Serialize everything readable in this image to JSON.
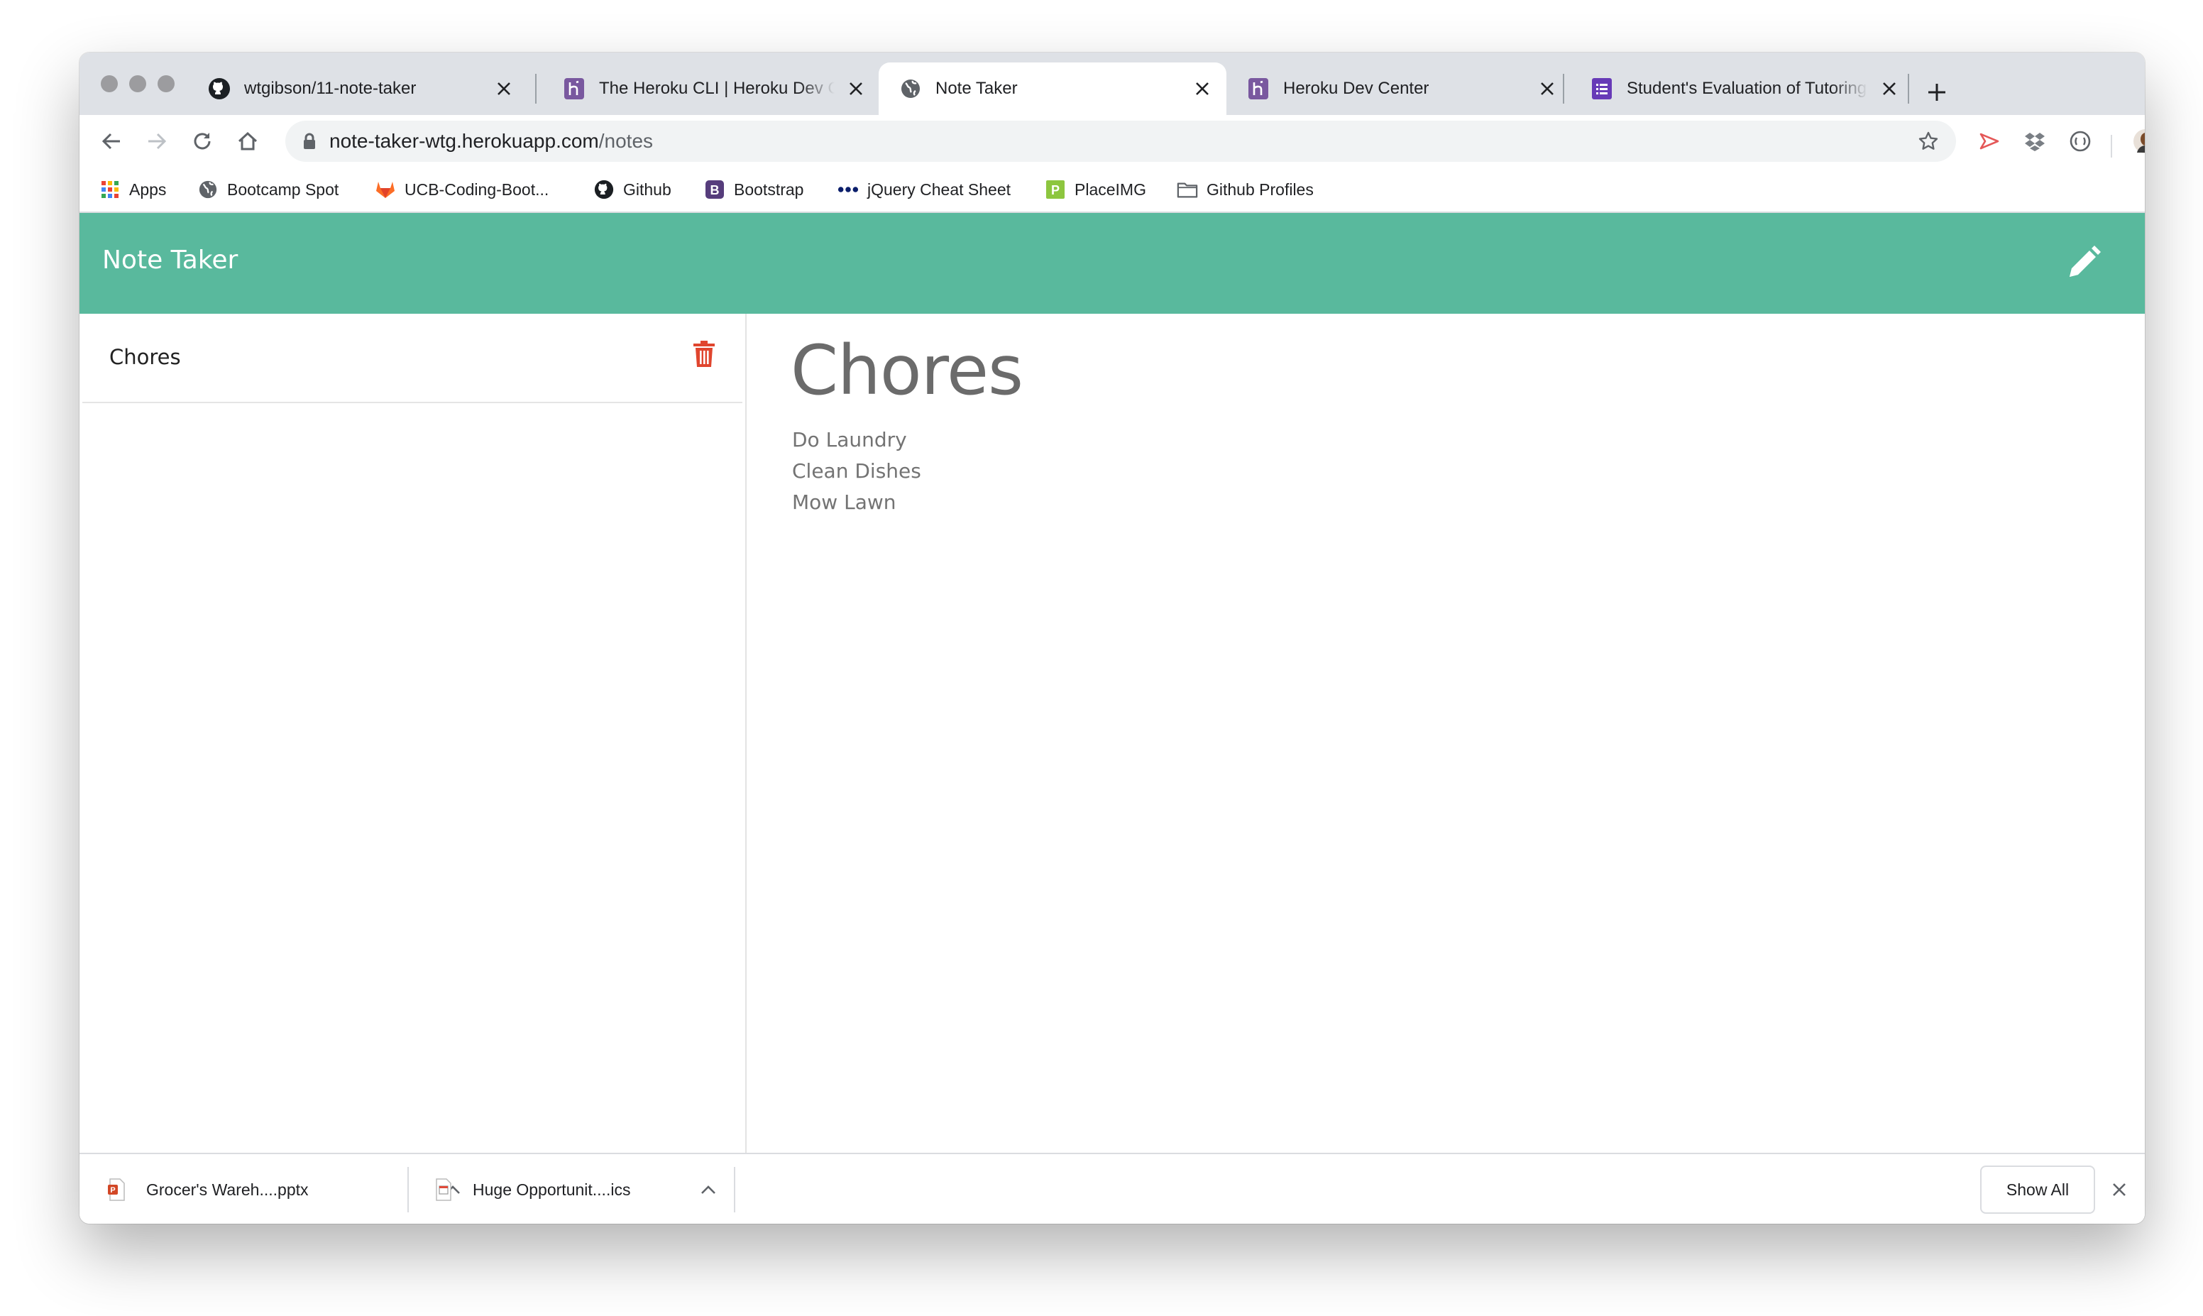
{
  "browser": {
    "tabs": [
      {
        "title": "wtgibson/11-note-taker",
        "icon": "github-icon",
        "active": false
      },
      {
        "title": "The Heroku CLI | Heroku Dev Center",
        "icon": "heroku-icon",
        "active": false
      },
      {
        "title": "Note Taker",
        "icon": "globe-icon",
        "active": true
      },
      {
        "title": "Heroku Dev Center",
        "icon": "heroku-icon",
        "active": false
      },
      {
        "title": "Student's Evaluation of Tutoring",
        "icon": "form-icon",
        "active": false
      }
    ],
    "address": {
      "host": "note-taker-wtg.herokuapp.com",
      "path": "/notes"
    },
    "bookmarks": [
      {
        "label": "Apps",
        "icon": "apps-grid-icon"
      },
      {
        "label": "Bootcamp Spot",
        "icon": "globe-icon"
      },
      {
        "label": "UCB-Coding-Boot...",
        "icon": "gitlab-icon"
      },
      {
        "label": "Github",
        "icon": "github-icon"
      },
      {
        "label": "Bootstrap",
        "icon": "bootstrap-icon"
      },
      {
        "label": "jQuery Cheat Sheet",
        "icon": "dots-icon"
      },
      {
        "label": "PlaceIMG",
        "icon": "placeimg-icon"
      },
      {
        "label": "Github Profiles",
        "icon": "folder-icon"
      }
    ]
  },
  "app": {
    "title": "Note Taker",
    "accent_color": "#59b99d",
    "notes": [
      {
        "title": "Chores"
      }
    ],
    "active_note": {
      "title": "Chores",
      "body": [
        "Do Laundry",
        "Clean Dishes",
        "Mow Lawn"
      ]
    }
  },
  "downloads": {
    "items": [
      {
        "name": "Grocer's Wareh....pptx",
        "icon": "pptx-file-icon"
      },
      {
        "name": "Huge Opportunit....ics",
        "icon": "ics-file-icon"
      }
    ],
    "show_all_label": "Show All"
  }
}
